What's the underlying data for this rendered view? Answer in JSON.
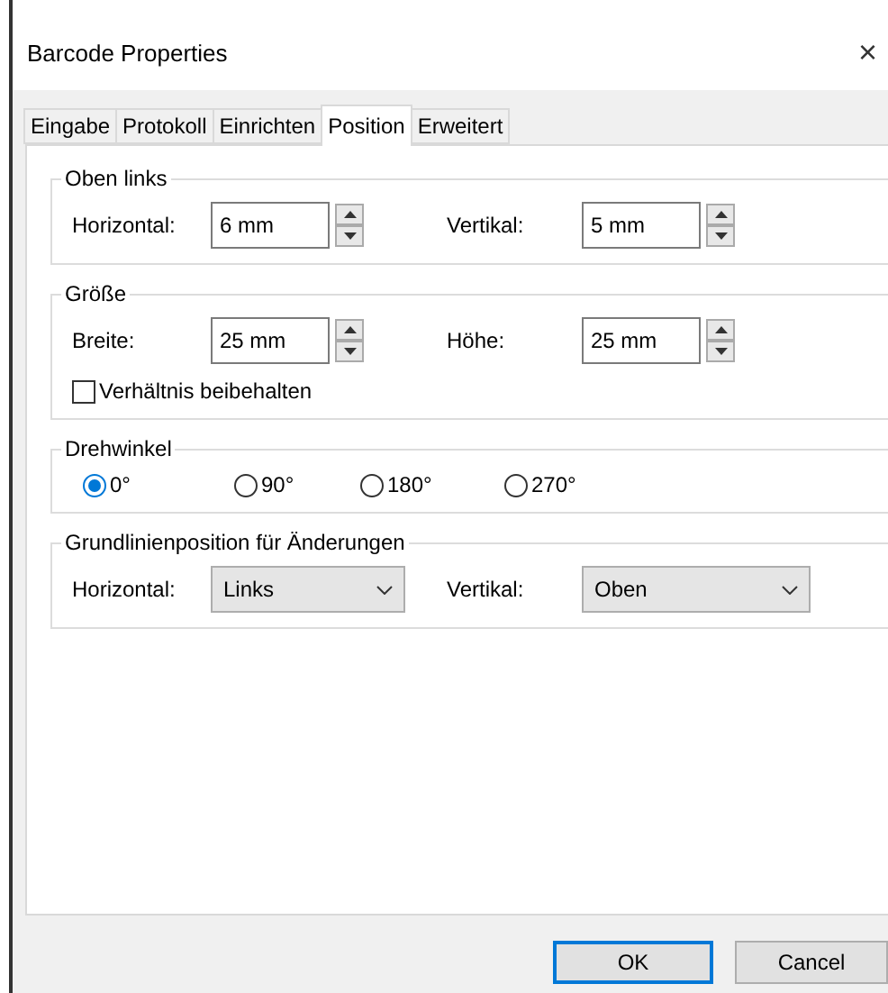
{
  "window": {
    "title": "Barcode Properties",
    "close": "×"
  },
  "tabs": [
    {
      "label": "Eingabe",
      "selected": false
    },
    {
      "label": "Protokoll",
      "selected": false
    },
    {
      "label": "Einrichten",
      "selected": false
    },
    {
      "label": "Position",
      "selected": true
    },
    {
      "label": "Erweitert",
      "selected": false
    }
  ],
  "groups": [
    {
      "kind": "spin",
      "title": "Oben links",
      "fields": [
        {
          "label": "Horizontal:",
          "value": "6 mm"
        },
        {
          "label": "Vertikal:",
          "value": "5 mm"
        }
      ]
    },
    {
      "kind": "spin",
      "title": "Größe",
      "fields": [
        {
          "label": "Breite:",
          "value": "25 mm"
        },
        {
          "label": "Höhe:",
          "value": "25 mm"
        }
      ],
      "checkbox": {
        "label": "Verhältnis beibehalten",
        "checked": false
      }
    },
    {
      "kind": "radio",
      "title": "Drehwinkel",
      "options": [
        {
          "label": "0°",
          "selected": true
        },
        {
          "label": "90°",
          "selected": false
        },
        {
          "label": "180°",
          "selected": false
        },
        {
          "label": "270°",
          "selected": false
        }
      ]
    },
    {
      "kind": "select",
      "title": "Grundlinienposition für Änderungen",
      "fields": [
        {
          "label": "Horizontal:",
          "value": "Links"
        },
        {
          "label": "Vertikal:",
          "value": "Oben"
        }
      ]
    }
  ],
  "buttons": [
    {
      "label": "OK",
      "default": true
    },
    {
      "label": "Cancel",
      "default": false
    }
  ]
}
